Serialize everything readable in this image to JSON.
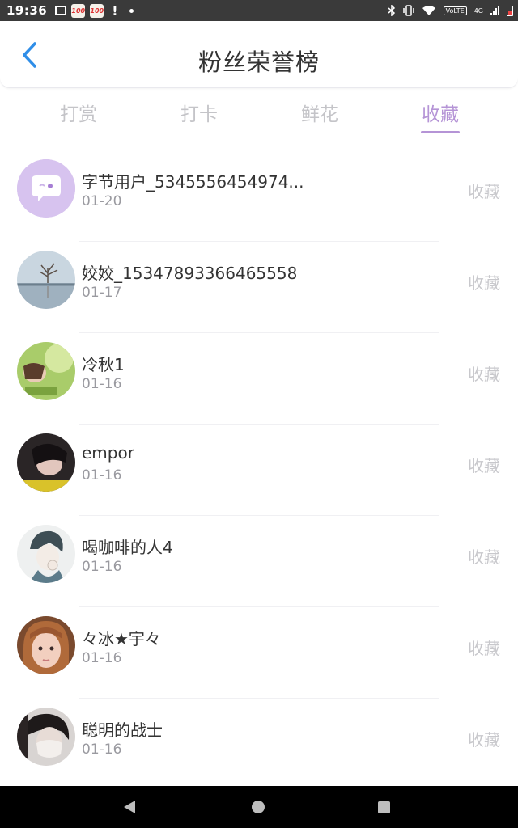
{
  "status_bar": {
    "time": "19:36",
    "app_badge_1": "100",
    "app_badge_2": "100",
    "volte": "VoLTE",
    "network": "4G"
  },
  "header": {
    "title": "粉丝荣誉榜",
    "back_icon": "chevron-left-icon"
  },
  "tabs": [
    {
      "label": "打赏",
      "active": false
    },
    {
      "label": "打卡",
      "active": false
    },
    {
      "label": "鲜花",
      "active": false
    },
    {
      "label": "收藏",
      "active": true
    }
  ],
  "colors": {
    "accent": "#b594d6",
    "back_icon": "#2f8ee8",
    "inactive_tab": "#c4c4c8"
  },
  "fans": [
    {
      "name": "字节用户_5345556454974...",
      "date": "01-20",
      "action": "收藏",
      "avatar": "chat-bubble-icon"
    },
    {
      "name": "姣姣_15347893366465558",
      "date": "01-17",
      "action": "收藏",
      "avatar": "photo-lake-tree"
    },
    {
      "name": "冷秋1",
      "date": "01-16",
      "action": "收藏",
      "avatar": "photo-green-field"
    },
    {
      "name": "empor",
      "date": "01-16",
      "action": "收藏",
      "avatar": "photo-dark-hair"
    },
    {
      "name": "喝咖啡的人4",
      "date": "01-16",
      "action": "收藏",
      "avatar": "photo-anime-boy"
    },
    {
      "name": "々冰★宇々",
      "date": "01-16",
      "action": "收藏",
      "avatar": "photo-girl-face"
    },
    {
      "name": "聪明的战士",
      "date": "01-16",
      "action": "收藏",
      "avatar": "photo-mask-person"
    }
  ]
}
